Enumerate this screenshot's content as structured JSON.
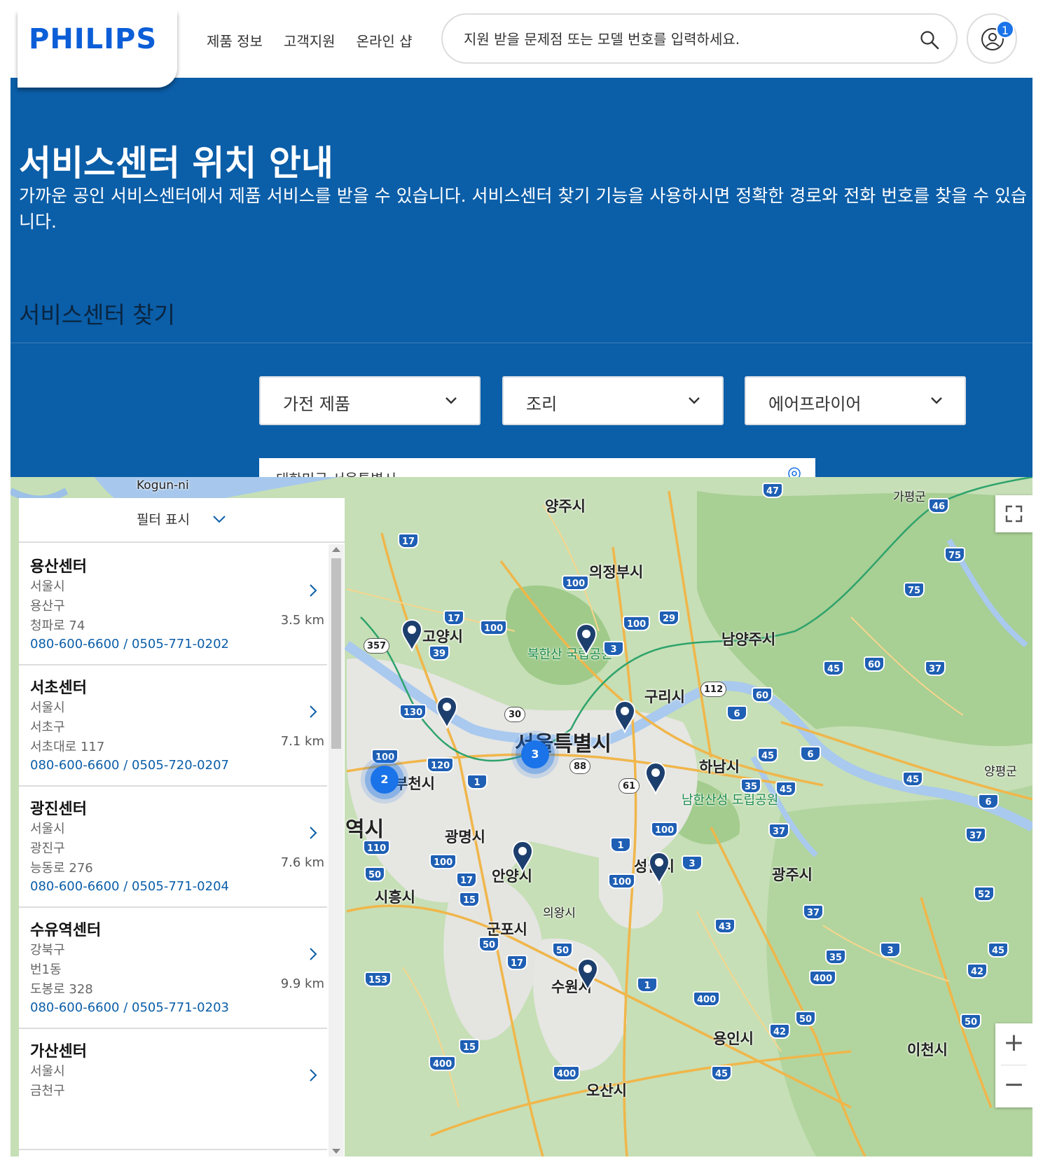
{
  "header": {
    "logo": "PHILIPS",
    "nav": [
      "제품 정보",
      "고객지원",
      "온라인 샵"
    ],
    "search_placeholder": "지원 받을 문제점 또는 모델 번호를 입력하세요.",
    "account_badge": "1"
  },
  "hero": {
    "title": "서비스센터 위치 안내",
    "description": "가까운 공인 서비스센터에서 제품 서비스를 받을 수 있습니다. 서비스센터 찾기 기능을 사용하시면 정확한 경로와 전화 번호를 찾을 수 있습니다.",
    "finder_title": "서비스센터 찾기"
  },
  "filters": {
    "category": "가전 제품",
    "subcategory": "조리",
    "product": "에어프라이어",
    "location": "대한민국 서울특별시"
  },
  "panel": {
    "filter_label": "필터 표시",
    "centers": [
      {
        "name": "용산센터",
        "lines": [
          "서울시",
          "용산구",
          "청파로 74"
        ],
        "phone": "080-600-6600 / 0505-771-0202",
        "distance": "3.5 km"
      },
      {
        "name": "서초센터",
        "lines": [
          "서울시",
          "서초구",
          "서초대로 117"
        ],
        "phone": "080-600-6600 / 0505-720-0207",
        "distance": "7.1 km"
      },
      {
        "name": "광진센터",
        "lines": [
          "서울시",
          "광진구",
          "능동로 276"
        ],
        "phone": "080-600-6600 / 0505-771-0204",
        "distance": "7.6 km"
      },
      {
        "name": "수유역센터",
        "lines": [
          "강북구",
          "번1동",
          "도봉로 328"
        ],
        "phone": "080-600-6600 / 0505-771-0203",
        "distance": "9.9 km"
      },
      {
        "name": "가산센터",
        "lines": [
          "서울시",
          "금천구",
          ""
        ],
        "phone": "",
        "distance": ""
      }
    ]
  },
  "map": {
    "labels": {
      "kogun": "Kogun-ni",
      "yangju": "양주시",
      "gapyeong": "가평군",
      "uijeongbu": "의정부시",
      "goyang": "고양시",
      "namyangju": "남양주시",
      "bukhansan": "북한산 국립공원",
      "guri": "구리시",
      "seoul": "서울특별시",
      "hanam": "하남시",
      "yangpyeong": "양평군",
      "bucheon": "부천시",
      "namhansan": "남한산성 도립공원",
      "yeoksi": "역시",
      "gwangmyeong": "광명시",
      "anyang": "안양시",
      "seongnam": "성남시",
      "gwangju": "광주시",
      "siheung": "시흥시",
      "uiwang": "의왕시",
      "gunpo": "군포시",
      "suwon": "수원시",
      "yongin": "용인시",
      "icheon": "이천시",
      "osan": "오산시"
    },
    "clusters": [
      "3",
      "2"
    ],
    "zoom_in": "+",
    "zoom_out": "−"
  },
  "colors": {
    "brand": "#0b5ed7",
    "hero_bg": "#0b5ea8",
    "link": "#0b5ea8",
    "cluster": "#1a73e8",
    "marker": "#1d3f6e"
  }
}
